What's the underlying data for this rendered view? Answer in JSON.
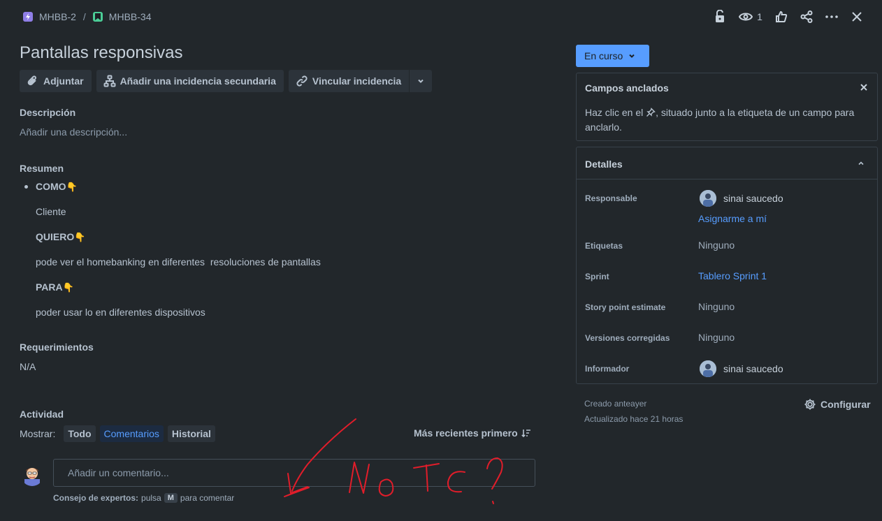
{
  "breadcrumb": [
    {
      "key": "MHBB-2",
      "icon": "lightning-icon",
      "color": "#8f7ee7"
    },
    {
      "key": "MHBB-34",
      "icon": "bookmark-icon",
      "color": "#4bce97"
    }
  ],
  "breadcrumb_separator": "/",
  "header": {
    "watchers_count": "1"
  },
  "issue": {
    "title": "Pantallas responsivas"
  },
  "actions": {
    "attach": "Adjuntar",
    "add_child": "Añadir una incidencia secundaria",
    "link_issue": "Vincular incidencia"
  },
  "description": {
    "label": "Descripción",
    "placeholder": "Añadir una descripción..."
  },
  "summary": {
    "label": "Resumen",
    "como": "COMO",
    "como_text": "Cliente",
    "quiero": "QUIERO",
    "quiero_text": "pode ver el homebanking en diferentes  resoluciones de pantallas",
    "para": "PARA",
    "para_text": "poder usar lo en diferentes dispositivos",
    "hand_emoji": "👇"
  },
  "requirements": {
    "label": "Requerimientos",
    "value": "N/A"
  },
  "activity": {
    "label": "Actividad",
    "show_label": "Mostrar:",
    "filters": [
      "Todo",
      "Comentarios",
      "Historial"
    ],
    "active_filter": "Comentarios",
    "sort_label": "Más recientes primero"
  },
  "comment": {
    "placeholder": "Añadir un comentario...",
    "tip_bold": "Consejo de expertos:",
    "tip_pre": "pulsa",
    "tip_key": "M",
    "tip_post": "para comentar"
  },
  "status": {
    "label": "En curso",
    "color": "#579dff"
  },
  "pinned": {
    "title": "Campos anclados",
    "text_pre": "Haz clic en el",
    "text_post": ", situado junto a la etiqueta de un campo para",
    "text_line2": "anclarlo."
  },
  "details": {
    "title": "Detalles",
    "assignee_label": "Responsable",
    "assignee": "sinai saucedo",
    "assign_to_me": "Asignarme a mí",
    "labels_label": "Etiquetas",
    "labels_value": "Ninguno",
    "sprint_label": "Sprint",
    "sprint_value": "Tablero Sprint 1",
    "story_points_label": "Story point estimate",
    "story_points_value": "Ninguno",
    "fix_versions_label": "Versiones corregidas",
    "fix_versions_value": "Ninguno",
    "reporter_label": "Informador",
    "reporter": "sinai saucedo"
  },
  "footer": {
    "created": "Creado anteayer",
    "updated": "Actualizado hace 21 horas",
    "configure": "Configurar"
  },
  "annotation": {
    "text": "No TC ?",
    "color": "#e11d2a"
  }
}
